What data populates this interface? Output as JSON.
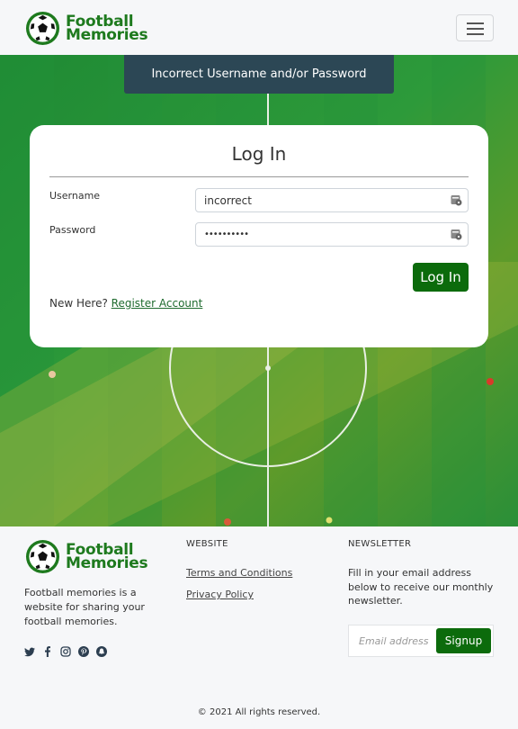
{
  "brand": {
    "line1": "Football",
    "line2": "Memories"
  },
  "nav": {
    "toggle_icon": "hamburger-icon"
  },
  "alert": {
    "message": "Incorrect Username and/or Password"
  },
  "login": {
    "title": "Log In",
    "username_label": "Username",
    "username_value": "incorrect",
    "password_label": "Password",
    "password_value": "••••••••••",
    "submit_label": "Log In",
    "new_here": "New Here?",
    "register_link": "Register Account"
  },
  "footer": {
    "description": "Football memories is a website for sharing your football memories.",
    "website_heading": "WEBSITE",
    "links": [
      "Terms and Conditions",
      "Privacy Policy"
    ],
    "newsletter_heading": "NEWSLETTER",
    "newsletter_text": "Fill in your email address below to receive our monthly newsletter.",
    "email_placeholder": "Email address",
    "signup_label": "Signup",
    "social_icons": [
      "twitter-icon",
      "facebook-icon",
      "instagram-icon",
      "pinterest-icon",
      "snapchat-icon"
    ],
    "copyright": "© 2021 All rights reserved."
  },
  "colors": {
    "brand_green": "#1e7a1e",
    "button_green": "#0c6b0c",
    "alert_bg": "#2c4755"
  }
}
